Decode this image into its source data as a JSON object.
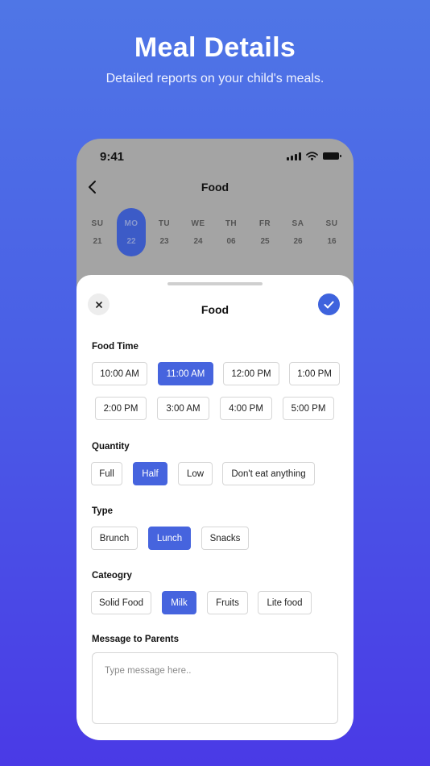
{
  "promo": {
    "headline": "Meal Details",
    "subhead": "Detailed reports on your child's meals."
  },
  "status_bar": {
    "time": "9:41",
    "icons": [
      "cellular-signal-icon",
      "wifi-icon",
      "battery-icon"
    ]
  },
  "nav": {
    "back_icon": "chevron-left-icon",
    "title": "Food"
  },
  "calendar": {
    "days": [
      {
        "name": "SU",
        "date": "21",
        "selected": false
      },
      {
        "name": "MO",
        "date": "22",
        "selected": true
      },
      {
        "name": "TU",
        "date": "23",
        "selected": false
      },
      {
        "name": "WE",
        "date": "24",
        "selected": false
      },
      {
        "name": "TH",
        "date": "06",
        "selected": false
      },
      {
        "name": "FR",
        "date": "25",
        "selected": false
      },
      {
        "name": "SA",
        "date": "26",
        "selected": false
      },
      {
        "name": "SU",
        "date": "16",
        "selected": false
      }
    ]
  },
  "sheet": {
    "title": "Food",
    "close_icon": "close-icon",
    "confirm_icon": "check-icon",
    "food_time": {
      "label": "Food Time",
      "options": [
        "10:00 AM",
        "11:00 AM",
        "12:00 PM",
        "1:00 PM",
        "2:00 PM",
        "3:00 AM",
        "4:00 PM",
        "5:00 PM"
      ],
      "selected": "11:00 AM"
    },
    "quantity": {
      "label": "Quantity",
      "options": [
        "Full",
        "Half",
        "Low",
        "Don't eat anything"
      ],
      "selected": "Half"
    },
    "type": {
      "label": "Type",
      "options": [
        "Brunch",
        "Lunch",
        "Snacks"
      ],
      "selected": "Lunch"
    },
    "category": {
      "label": "Cateogry",
      "options": [
        "Solid Food",
        "Milk",
        "Fruits",
        "Lite food"
      ],
      "selected": "Milk"
    },
    "message": {
      "label": "Message to Parents",
      "placeholder": "Type message here..",
      "value": ""
    }
  },
  "colors": {
    "accent": "#4664de",
    "overlay_gray": "#a4a4a4",
    "selected_day": "#3c5bc7"
  }
}
